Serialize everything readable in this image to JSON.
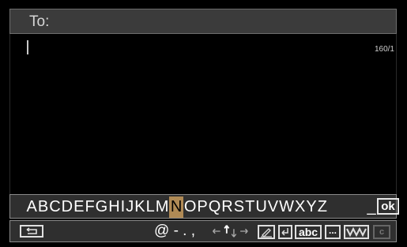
{
  "to_field": {
    "label": "To:"
  },
  "message": {
    "char_counter": "160/1"
  },
  "keyboard": {
    "letters": [
      "A",
      "B",
      "C",
      "D",
      "E",
      "F",
      "G",
      "H",
      "I",
      "J",
      "K",
      "L",
      "M",
      "N",
      "O",
      "P",
      "Q",
      "R",
      "S",
      "T",
      "U",
      "V",
      "W",
      "X",
      "Y",
      "Z"
    ],
    "selected": "N",
    "space_label": "_",
    "ok_label": "ok"
  },
  "symbol_row": {
    "symbols": "@ - . ,",
    "abc_label": "abc",
    "ellipsis_label": "...",
    "clear_label": "c"
  },
  "colors": {
    "selected_key": "#b08a55",
    "panel": "#2f2f2f",
    "border": "#8a8a8a"
  }
}
